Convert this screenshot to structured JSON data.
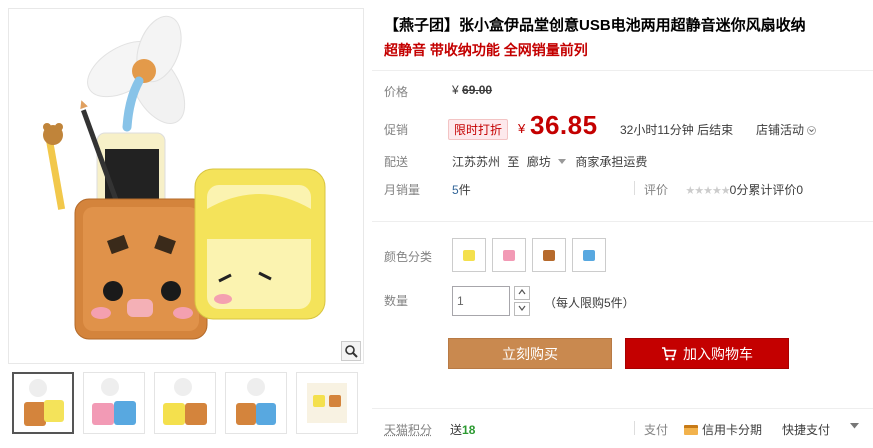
{
  "product": {
    "title": "【燕子团】张小盒伊品堂创意USB电池两用超静音迷你风扇收纳",
    "subtitle": "超静音 带收纳功能 全网销量前列"
  },
  "price_row": {
    "label": "价格",
    "currency": "¥",
    "original": "69.00"
  },
  "promo_row": {
    "label": "促销",
    "tag": "限时打折",
    "currency": "¥",
    "price": "36.85",
    "countdown": "32小时11分钟 后结束",
    "shop_activity": "店铺活动"
  },
  "ship_row": {
    "label": "配送",
    "from": "江苏苏州",
    "to_word": "至",
    "dest": "廊坊",
    "fee": "商家承担运费"
  },
  "sales_row": {
    "label": "月销量",
    "count": "5",
    "unit": "件",
    "rating_label": "评价",
    "rating_score": "0分",
    "review_text": "累计评价0"
  },
  "color_row": {
    "label": "颜色分类",
    "swatches": [
      {
        "color": "#f4e04d"
      },
      {
        "color": "#f29ab5"
      },
      {
        "color": "#b66a2c"
      },
      {
        "color": "#58a8e0"
      }
    ]
  },
  "qty_row": {
    "label": "数量",
    "value": "1",
    "limit": "（每人限购5件）"
  },
  "buttons": {
    "buy": "立刻购买",
    "cart": "加入购物车"
  },
  "footer": {
    "points_label": "天猫积分",
    "points_prefix": "送",
    "points": "18",
    "pay_label": "支付",
    "pay_card": "信用卡分期",
    "pay_quick": "快捷支付"
  },
  "gallery": {
    "thumb_count": 5,
    "active_index": 0
  },
  "icons": [
    "zoom-icon",
    "cart-icon",
    "chevron-down-icon",
    "credit-card-icon",
    "triangle-down-icon"
  ]
}
